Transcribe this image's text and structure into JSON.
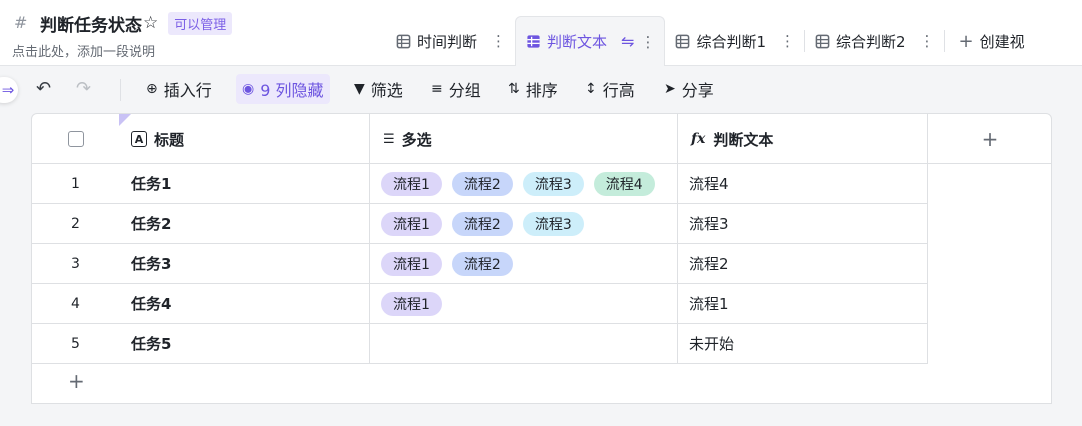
{
  "header": {
    "title": "判断任务状态",
    "manage_badge": "可以管理",
    "subtitle": "点击此处，添加一段说明"
  },
  "tabs": [
    {
      "label": "时间判断",
      "active": false
    },
    {
      "label": "判断文本",
      "active": true
    },
    {
      "label": "综合判断1",
      "active": false
    },
    {
      "label": "综合判断2",
      "active": false
    }
  ],
  "create_tab": "创建视",
  "toolbar": {
    "insert_row": "插入行",
    "hidden_cols": "9 列隐藏",
    "filter": "筛选",
    "group": "分组",
    "sort": "排序",
    "row_height": "行高",
    "share": "分享"
  },
  "columns": {
    "title": "标题",
    "multi": "多选",
    "formula": "判断文本"
  },
  "rows": [
    {
      "num": "1",
      "name": "任务1",
      "tags": [
        "流程1",
        "流程2",
        "流程3",
        "流程4"
      ],
      "judge": "流程4"
    },
    {
      "num": "2",
      "name": "任务2",
      "tags": [
        "流程1",
        "流程2",
        "流程3"
      ],
      "judge": "流程3"
    },
    {
      "num": "3",
      "name": "任务3",
      "tags": [
        "流程1",
        "流程2"
      ],
      "judge": "流程2"
    },
    {
      "num": "4",
      "name": "任务4",
      "tags": [
        "流程1"
      ],
      "judge": "流程1"
    },
    {
      "num": "5",
      "name": "任务5",
      "tags": [],
      "judge": "未开始"
    }
  ],
  "colors": {
    "accent": "#6d55e0",
    "tag_1": "#dcd6f9",
    "tag_2": "#c7d6fa",
    "tag_3": "#cdeefa",
    "tag_4": "#c4ecdb"
  }
}
